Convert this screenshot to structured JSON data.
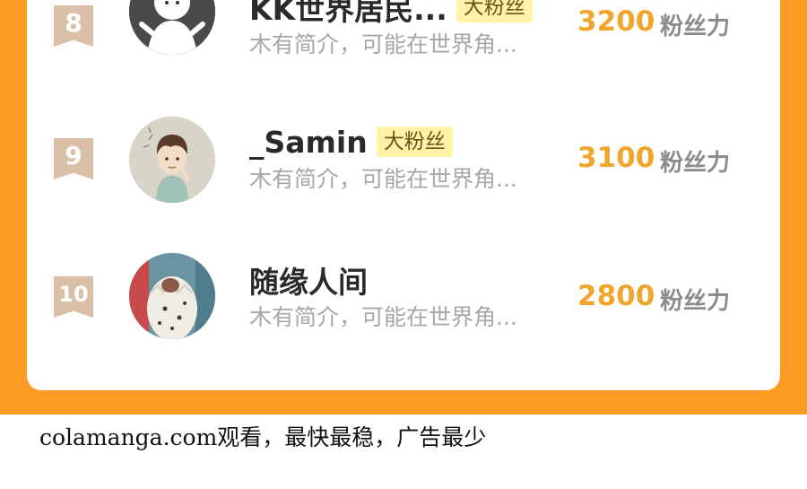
{
  "leaderboard": {
    "score_unit": "粉丝力",
    "rows": [
      {
        "rank": "8",
        "name": "KK世界居民...",
        "badge": "大粉丝",
        "bio": "木有简介，可能在世界角...",
        "score": "3200"
      },
      {
        "rank": "9",
        "name": "_Samin",
        "badge": "大粉丝",
        "bio": "木有简介，可能在世界角...",
        "score": "3100"
      },
      {
        "rank": "10",
        "name": "随缘人间",
        "badge": "",
        "bio": "木有简介，可能在世界角...",
        "score": "2800"
      }
    ]
  },
  "footer": {
    "watermark": "colamanga.com观看，最快最稳，广告最少"
  },
  "colors": {
    "frame": "#fb9b22",
    "score": "#f0a62c",
    "badge_bg": "#fff3a8",
    "rank_badge": "#d9bfa6"
  }
}
